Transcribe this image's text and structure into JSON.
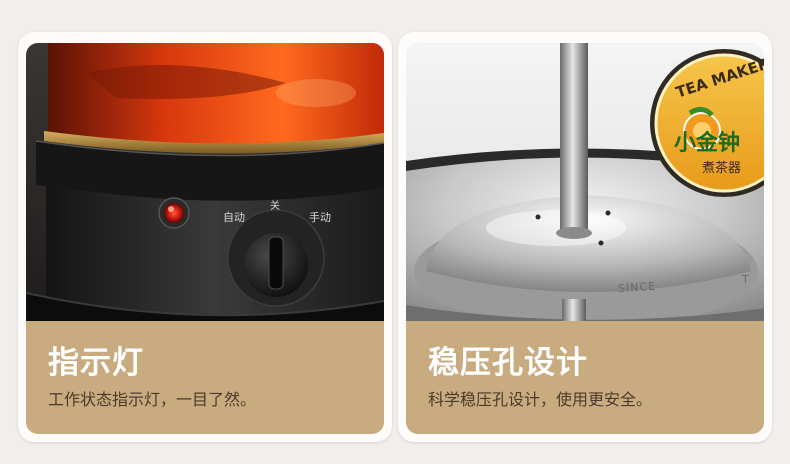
{
  "cards": [
    {
      "title": "指示灯",
      "subtitle": "工作状态指示灯，一目了然。",
      "knob_labels": {
        "left": "自动",
        "top": "关",
        "right": "手动"
      }
    },
    {
      "title": "稳压孔设计",
      "subtitle": "科学稳压孔设计，使用更安全。",
      "badge": {
        "arc_text": "TEA MAKER",
        "brand": "小金钟",
        "product": "煮茶器"
      },
      "engraving": "SINCE",
      "engraving_short": "T"
    }
  ],
  "colors": {
    "caption_bg": "#c9ab80",
    "caption_title": "#ffffff",
    "caption_sub": "#4a3b2a",
    "indicator_red": "#e0301e"
  }
}
